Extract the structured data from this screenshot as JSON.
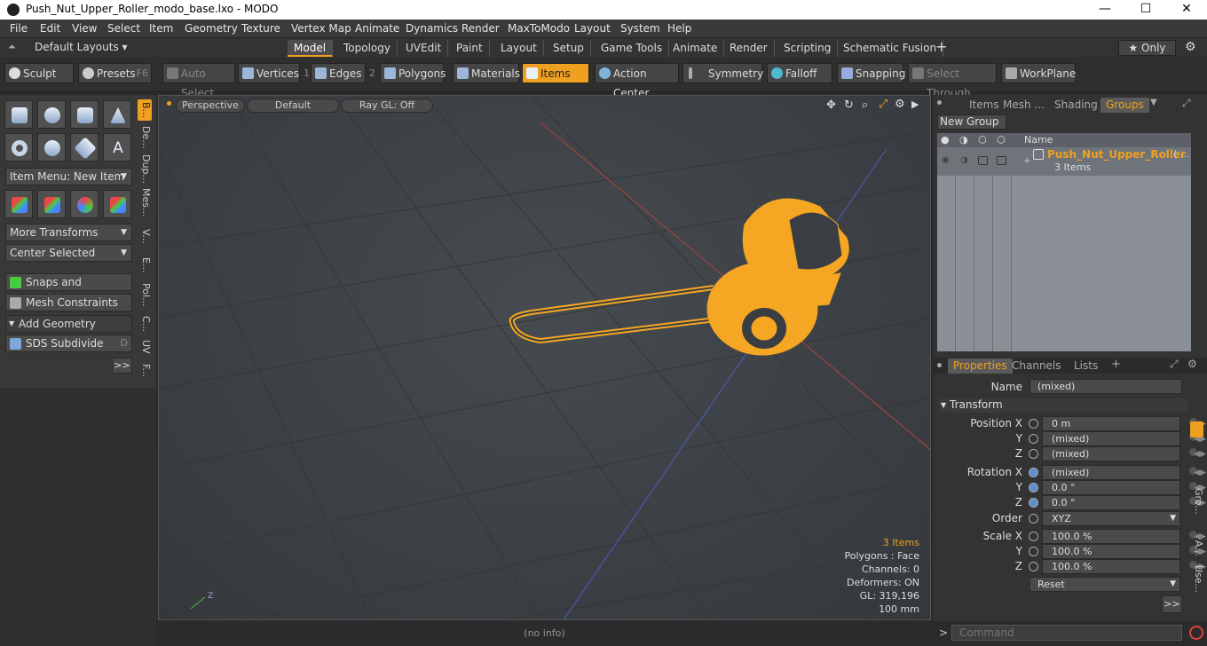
{
  "window": {
    "title": "Push_Nut_Upper_Roller_modo_base.lxo - MODO",
    "minimize": "—",
    "maximize": "☐",
    "close": "✕"
  },
  "menu": [
    "File",
    "Edit",
    "View",
    "Select",
    "Item",
    "Geometry",
    "Texture",
    "Vertex Map",
    "Animate",
    "Dynamics",
    "Render",
    "MaxToModo",
    "Layout",
    "System",
    "Help"
  ],
  "layoutbar": {
    "layout_selector": "Default Layouts ▾",
    "tabs": [
      "Model",
      "Topology",
      "UVEdit",
      "Paint",
      "Layout",
      "Setup",
      "Game Tools",
      "Animate",
      "Render",
      "Scripting",
      "Schematic Fusion"
    ],
    "active_tab": "Model",
    "add": "+",
    "only": "★  Only",
    "settings": "⚙"
  },
  "toolbar": {
    "sculpt": "Sculpt",
    "presets": "Presets",
    "presets_key": "F6",
    "auto_select": "Auto Select",
    "vertices": "Vertices",
    "vertices_num": "1",
    "edges": "Edges",
    "edges_num": "2",
    "polygons": "Polygons",
    "materials": "Materials",
    "items": "Items",
    "action_center": "Action Center",
    "symmetry": "Symmetry",
    "falloff": "Falloff",
    "snapping": "Snapping",
    "select_through": "Select Through",
    "workplane": "WorkPlane"
  },
  "leftpanel": {
    "item_menu": "Item Menu: New Item",
    "more_transforms": "More Transforms",
    "center_selected": "Center Selected",
    "snaps": "Snaps and Precision",
    "mesh_constraints": "Mesh Constraints",
    "add_geometry": "Add Geometry",
    "sds_subdivide": "SDS Subdivide",
    "sds_key": "D",
    "expand": ">>",
    "vtabs": [
      "B...",
      "De...",
      "Dup...",
      "Mes...",
      "V...",
      "E...",
      "Pol...",
      "C...",
      "UV",
      "F..."
    ]
  },
  "viewport": {
    "perspective": "Perspective",
    "default": "Default",
    "raygl": "Ray GL: Off",
    "info": {
      "items": "3 Items",
      "polygons": "Polygons : Face",
      "channels": "Channels: 0",
      "deformers": "Deformers: ON",
      "gl": "GL: 319,196",
      "size": "100 mm"
    },
    "status": "(no info)"
  },
  "rightpanel": {
    "tabs": [
      "Items",
      "Mesh ...",
      "Shading",
      "Groups"
    ],
    "active_tab": "Groups",
    "new_group": "New Group",
    "col_name": "Name",
    "group_name": "Push_Nut_Upper_Roller",
    "group_suffix": "( ...",
    "group_count": "3 Items",
    "prop_tabs": [
      "Properties",
      "Channels",
      "Lists"
    ],
    "active_prop_tab": "Properties",
    "name_label": "Name",
    "name_value": "(mixed)",
    "transform": "Transform",
    "position_x_label": "Position X",
    "position_x": "0 m",
    "position_y": "(mixed)",
    "position_z": "(mixed)",
    "rotation_x_label": "Rotation X",
    "rotation_x": "(mixed)",
    "rotation_y": "0.0 °",
    "rotation_z": "0.0 °",
    "order_label": "Order",
    "order": "XYZ",
    "scale_x_label": "Scale X",
    "scale_x": "100.0 %",
    "scale_y": "100.0 %",
    "scale_z": "100.0 %",
    "y": "Y",
    "z": "Z",
    "reset": "Reset",
    "expand": ">>",
    "side_tabs": [
      "Gro...",
      "A...",
      "Use..."
    ],
    "command_placeholder": "Command",
    "command_prompt": ">"
  },
  "colors": {
    "accent": "#f0a020",
    "mesh": "#f5a623"
  }
}
